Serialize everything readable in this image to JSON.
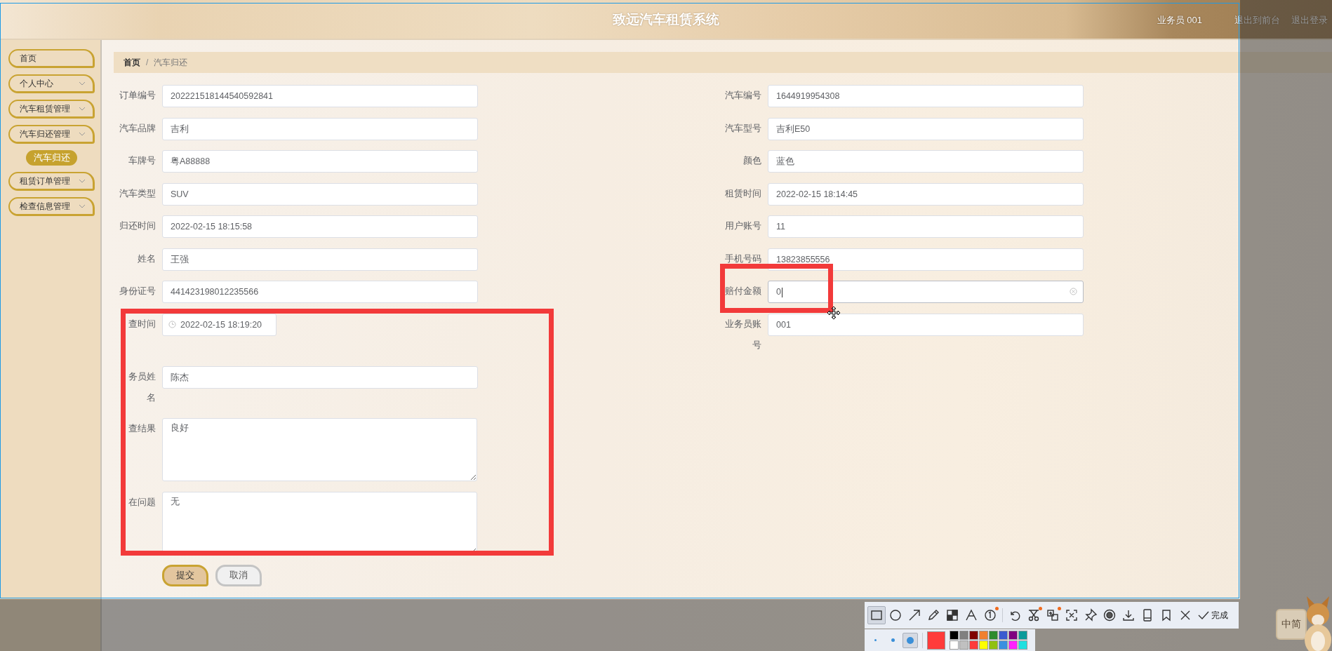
{
  "header": {
    "title": "致远汽车租赁系统",
    "user": "业务员 001",
    "links": [
      "退出到前台",
      "退出登录"
    ]
  },
  "sidebar": {
    "items": [
      {
        "label": "首页",
        "kind": "link"
      },
      {
        "label": "个人中心",
        "kind": "menu"
      },
      {
        "label": "汽车租赁管理",
        "kind": "menu"
      },
      {
        "label": "汽车归还管理",
        "kind": "menu",
        "children": [
          {
            "label": "汽车归还",
            "selected": true
          }
        ]
      },
      {
        "label": "租赁订单管理",
        "kind": "menu"
      },
      {
        "label": "检查信息管理",
        "kind": "menu"
      }
    ]
  },
  "breadcrumb": [
    "首页",
    "汽车归还"
  ],
  "breadcrumb_separator": "/",
  "form": {
    "left": [
      {
        "label": "订单编号",
        "value": "202221518144540592841",
        "kind": "text"
      },
      {
        "label": "汽车品牌",
        "value": "吉利",
        "kind": "text"
      },
      {
        "label": "车牌号",
        "value": "粤A88888",
        "kind": "text"
      },
      {
        "label": "汽车类型",
        "value": "SUV",
        "kind": "text"
      },
      {
        "label": "归还时间",
        "value": "2022-02-15 18:15:58",
        "kind": "text"
      },
      {
        "label": "姓名",
        "value": "王强",
        "kind": "text"
      },
      {
        "label": "身份证号",
        "value": "441423198012235566",
        "kind": "text"
      },
      {
        "label": "查时间",
        "value": "2022-02-15 18:19:20",
        "kind": "date"
      },
      {
        "label": "务员姓",
        "label_continued": "名",
        "value": "陈杰",
        "kind": "text"
      },
      {
        "label": "查结果",
        "value": "良好",
        "kind": "textarea"
      },
      {
        "label": "在问题",
        "value": "无",
        "kind": "textarea"
      }
    ],
    "right": [
      {
        "label": "汽车编号",
        "value": "1644919954308",
        "focused": false
      },
      {
        "label": "汽车型号",
        "value": "吉利E50",
        "focused": false
      },
      {
        "label": "颜色",
        "value": "蓝色",
        "focused": false
      },
      {
        "label": "租赁时间",
        "value": "2022-02-15 18:14:45",
        "focused": false
      },
      {
        "label": "用户账号",
        "value": "11",
        "focused": false
      },
      {
        "label": "手机号码",
        "value": "13823855556",
        "focused": false
      },
      {
        "label": "赔付金额",
        "value": "0",
        "focused": true
      },
      {
        "label": "业务员账号",
        "value": "001",
        "focused": false
      }
    ],
    "buttons": [
      {
        "label": "提交",
        "kind": "primary"
      },
      {
        "label": "取消",
        "kind": "default"
      }
    ]
  },
  "screenshot_toolbar": {
    "tools": [
      {
        "kind": "rectangle",
        "selected": true,
        "badge": false
      },
      {
        "kind": "circle",
        "selected": false,
        "badge": false
      },
      {
        "kind": "arrow",
        "selected": false,
        "badge": false
      },
      {
        "kind": "pencil",
        "selected": false,
        "badge": false
      },
      {
        "kind": "mosaic",
        "selected": false,
        "badge": false
      },
      {
        "kind": "text",
        "selected": false,
        "badge": false
      },
      {
        "kind": "number",
        "selected": false,
        "badge": true
      },
      {
        "kind": "undo",
        "selected": false,
        "badge": false
      },
      {
        "kind": "scissors",
        "selected": false,
        "badge": true
      },
      {
        "kind": "translate",
        "selected": false,
        "badge": true
      },
      {
        "kind": "scan",
        "selected": false,
        "badge": false
      },
      {
        "kind": "pin",
        "selected": false,
        "badge": false
      },
      {
        "kind": "record",
        "selected": false,
        "badge": false
      },
      {
        "kind": "download",
        "selected": false,
        "badge": false
      },
      {
        "kind": "phone",
        "selected": false,
        "badge": false
      },
      {
        "kind": "bookmark",
        "selected": false,
        "badge": false
      },
      {
        "kind": "close",
        "selected": false,
        "badge": false
      }
    ],
    "done": "完成",
    "sizes": [
      {
        "kind": "small",
        "selected": false
      },
      {
        "kind": "medium",
        "selected": false
      },
      {
        "kind": "large",
        "selected": true
      }
    ],
    "color": "#ff3b3b",
    "palette": [
      {
        "color": "#000000"
      },
      {
        "color": "#808080"
      },
      {
        "color": "#800000"
      },
      {
        "color": "#f08030"
      },
      {
        "color": "#2e8b2e"
      },
      {
        "color": "#3a5bd0"
      },
      {
        "color": "#800080"
      },
      {
        "color": "#0a9a9a"
      },
      {
        "color": "#ffffff"
      },
      {
        "color": "#c0c0c0"
      },
      {
        "color": "#ff3b3b"
      },
      {
        "color": "#ffff00"
      },
      {
        "color": "#90c010"
      },
      {
        "color": "#3a90e0"
      },
      {
        "color": "#ff20ff"
      },
      {
        "color": "#20e0e0"
      }
    ]
  },
  "ime": {
    "label": "中简"
  }
}
